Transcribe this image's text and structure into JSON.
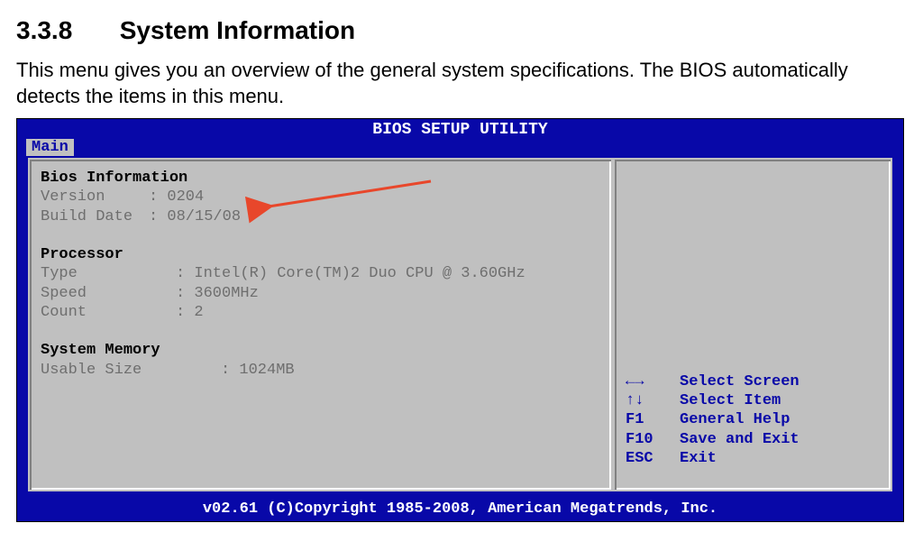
{
  "heading": {
    "number": "3.3.8",
    "title": "System Information"
  },
  "intro": "This menu gives you an overview of the general system specifications. The BIOS automatically detects the items in this menu.",
  "bios": {
    "title": "BIOS SETUP UTILITY",
    "tab": "Main",
    "sections": {
      "bios_info": {
        "header": "Bios Information",
        "version_label": "Version",
        "version_value": "0204",
        "build_label": "Build Date",
        "build_value": "08/15/08"
      },
      "processor": {
        "header": "Processor",
        "type_label": "Type",
        "type_value": "Intel(R) Core(TM)2 Duo CPU @ 3.60GHz",
        "speed_label": "Speed",
        "speed_value": "3600MHz",
        "count_label": "Count",
        "count_value": "2"
      },
      "memory": {
        "header": "System Memory",
        "usable_label": "Usable Size",
        "usable_value": "1024MB"
      }
    },
    "nav": [
      {
        "key_glyph": "←→",
        "label": "Select Screen"
      },
      {
        "key_glyph": "↑↓",
        "label": "Select Item"
      },
      {
        "key_glyph": "F1",
        "label": "General Help"
      },
      {
        "key_glyph": "F10",
        "label": "Save and Exit"
      },
      {
        "key_glyph": "ESC",
        "label": "Exit"
      }
    ],
    "footer": "v02.61 (C)Copyright 1985-2008, American Megatrends, Inc."
  }
}
